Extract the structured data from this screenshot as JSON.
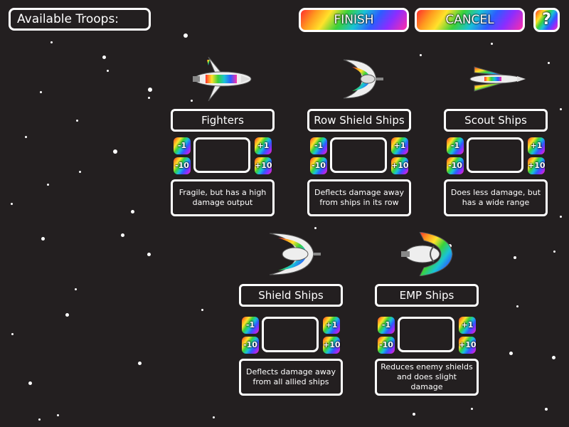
{
  "header": {
    "available_troops_label": "Available Troops:",
    "finish_label": "FINISH",
    "cancel_label": "CANCEL",
    "help_label": "?"
  },
  "steppers": {
    "minus_one": "-1",
    "plus_one": "+1",
    "minus_ten": "-10",
    "plus_ten": "+10"
  },
  "ships": [
    {
      "name": "Fighters",
      "description": "Fragile, but has a high damage output",
      "quantity": ""
    },
    {
      "name": "Row Shield Ships",
      "description": "Deflects damage away from ships in its row",
      "quantity": ""
    },
    {
      "name": "Scout Ships",
      "description": "Does less damage, but has a wide range",
      "quantity": ""
    },
    {
      "name": "Shield Ships",
      "description": "Deflects damage away from all allied ships",
      "quantity": ""
    },
    {
      "name": "EMP Ships",
      "description": "Reduces enemy shields and does slight damage",
      "quantity": ""
    }
  ],
  "colors": {
    "background": "#231f20",
    "border": "#ffffff",
    "accent": "rainbow-gradient"
  },
  "icons": [
    "fighter-ship-icon",
    "row-shield-ship-icon",
    "scout-ship-icon",
    "shield-ship-icon",
    "emp-ship-icon"
  ]
}
